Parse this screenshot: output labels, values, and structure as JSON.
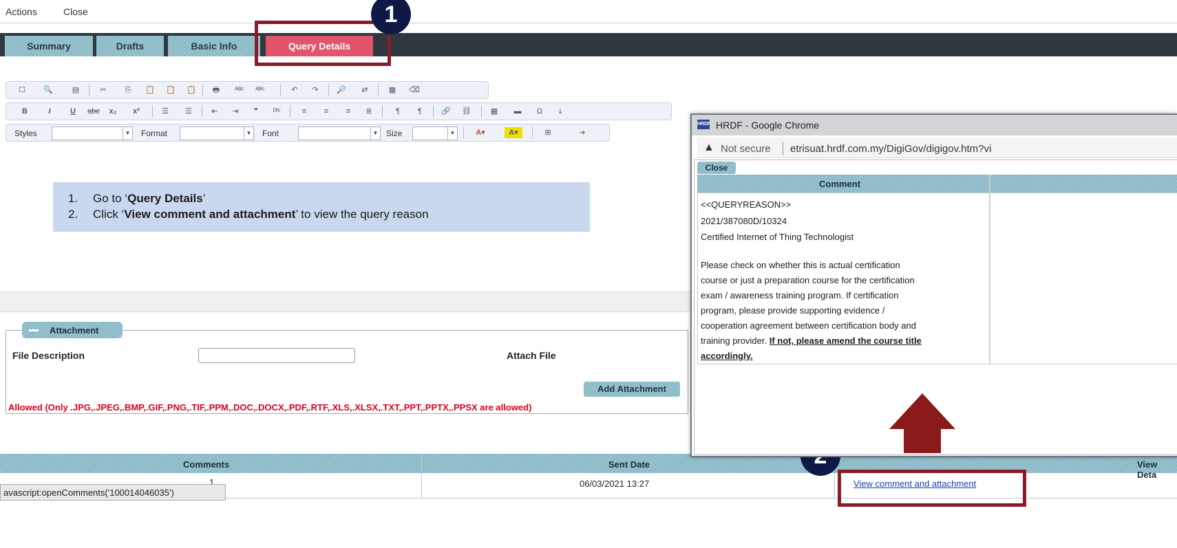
{
  "menu": {
    "actions": "Actions",
    "close": "Close"
  },
  "tabs": [
    {
      "label": "Summary"
    },
    {
      "label": "Drafts"
    },
    {
      "label": "Basic Info"
    },
    {
      "label": "Query Details"
    }
  ],
  "badges": {
    "one": "1",
    "two": "2"
  },
  "toolbar": {
    "styles_label": "Styles",
    "format_label": "Format",
    "font_label": "Font",
    "size_label": "Size"
  },
  "instruction": {
    "step1_num": "1.",
    "step1_pre": "Go to ‘",
    "step1_bold": "Query Details",
    "step1_post": "’",
    "step2_num": "2.",
    "step2_pre": "Click ‘",
    "step2_bold": "View comment and attachment",
    "step2_post": "’ to view the query reason"
  },
  "attachment": {
    "legend": "Attachment",
    "file_description_label": "File Description",
    "attach_file_label": "Attach File",
    "add_button": "Add Attachment",
    "allowed_text": "Allowed (Only .JPG,.JPEG,.BMP,.GIF,.PNG,.TIF,.PPM,.DOC,.DOCX,.PDF,.RTF,.XLS,.XLSX,.TXT,.PPT,.PPTX,.PPSX are allowed)"
  },
  "comments_table": {
    "headers": {
      "comments": "Comments",
      "sent_date": "Sent Date",
      "view_details": "View Deta"
    },
    "row": {
      "comment": "1",
      "sent_date": "06/03/2021 13:27",
      "link": "View comment and attachment"
    }
  },
  "status_tip": "avascript:openComments('100014046035')",
  "popup": {
    "title": "HRDF - Google Chrome",
    "logo_text": "HRDF",
    "not_secure": "Not secure",
    "url": "etrisuat.hrdf.com.my/DigiGov/digigov.htm?vi",
    "close_button": "Close",
    "comment_header": "Comment",
    "comment_lines": [
      "<<QUERYREASON>>",
      "2021/387080D/10324",
      "Certified Internet of Thing Technologist",
      "Please check on whether this is actual certification",
      "course or just a preparation course for the certification",
      "exam / awareness training program. If certification",
      "program, please provide supporting evidence /",
      "cooperation agreement between certification body and",
      "training provider. "
    ],
    "comment_emphasis_1": "If not, please amend the course title",
    "comment_emphasis_2": "accordingly."
  },
  "colors": {
    "accent_tab": "#e2546b",
    "highlight_box": "#8a1c2a",
    "badge": "#0e1a45",
    "arrow": "#8b1a1a",
    "error_text": "#e0001a",
    "link": "#1a3fa8"
  },
  "icons": [
    "warning-icon",
    "minus-icon",
    "arrow-up-icon"
  ]
}
